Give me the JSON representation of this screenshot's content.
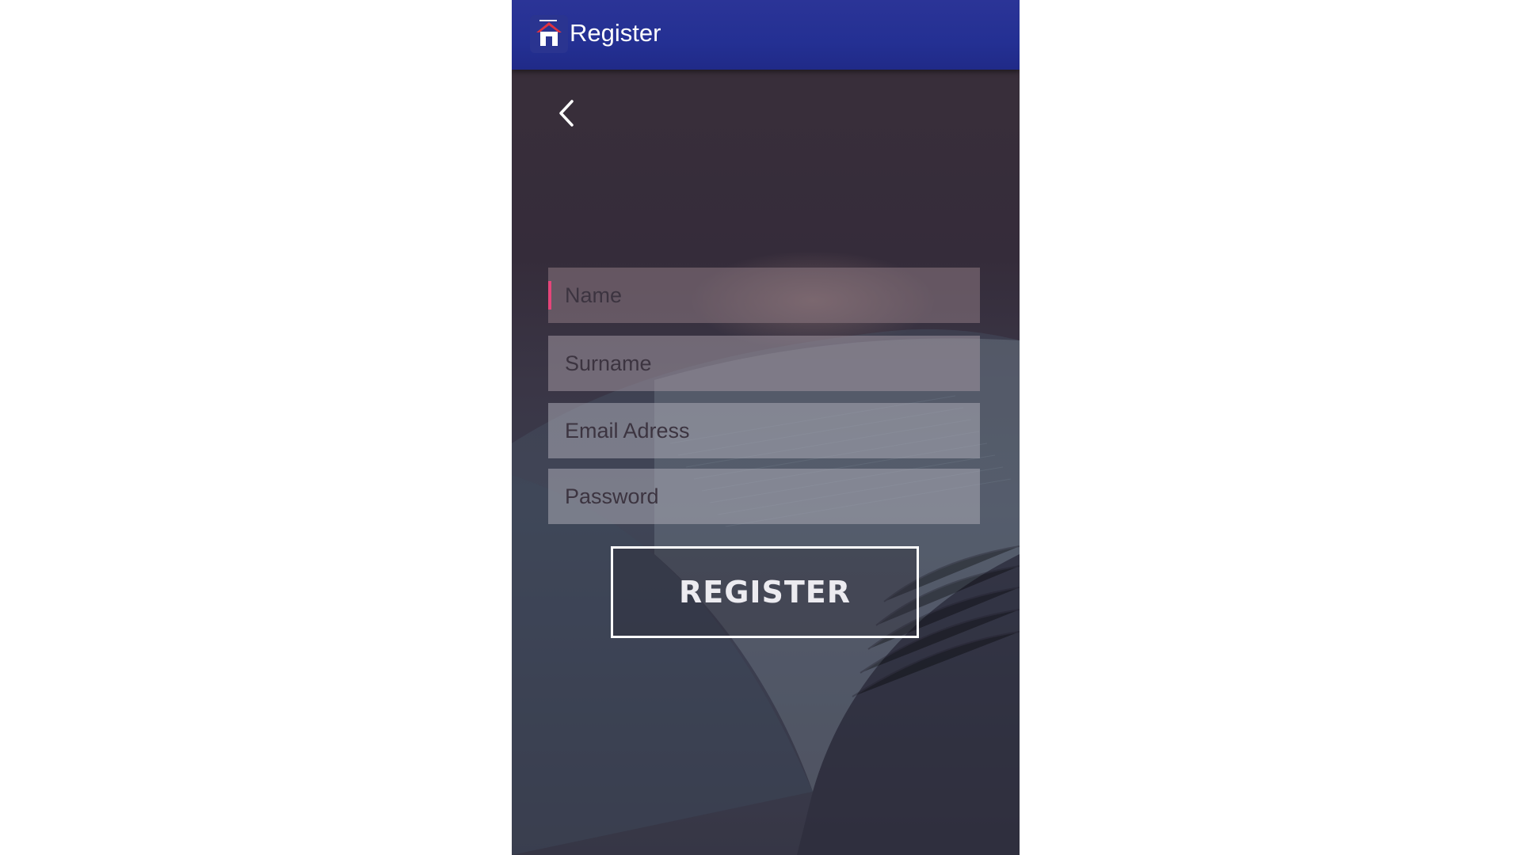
{
  "app_bar": {
    "title": "Register",
    "logo_icon": "home-icon"
  },
  "navigation": {
    "back_icon": "chevron-left-icon"
  },
  "form": {
    "fields": [
      {
        "placeholder": "Name",
        "focused": true
      },
      {
        "placeholder": "Surname",
        "focused": false
      },
      {
        "placeholder": "Email Adress",
        "focused": false
      },
      {
        "placeholder": "Password",
        "focused": false
      }
    ],
    "submit_label": "REGISTER"
  },
  "colors": {
    "app_bar": "#243093",
    "focus_caret": "#e5457a",
    "button_border": "#ffffff"
  }
}
